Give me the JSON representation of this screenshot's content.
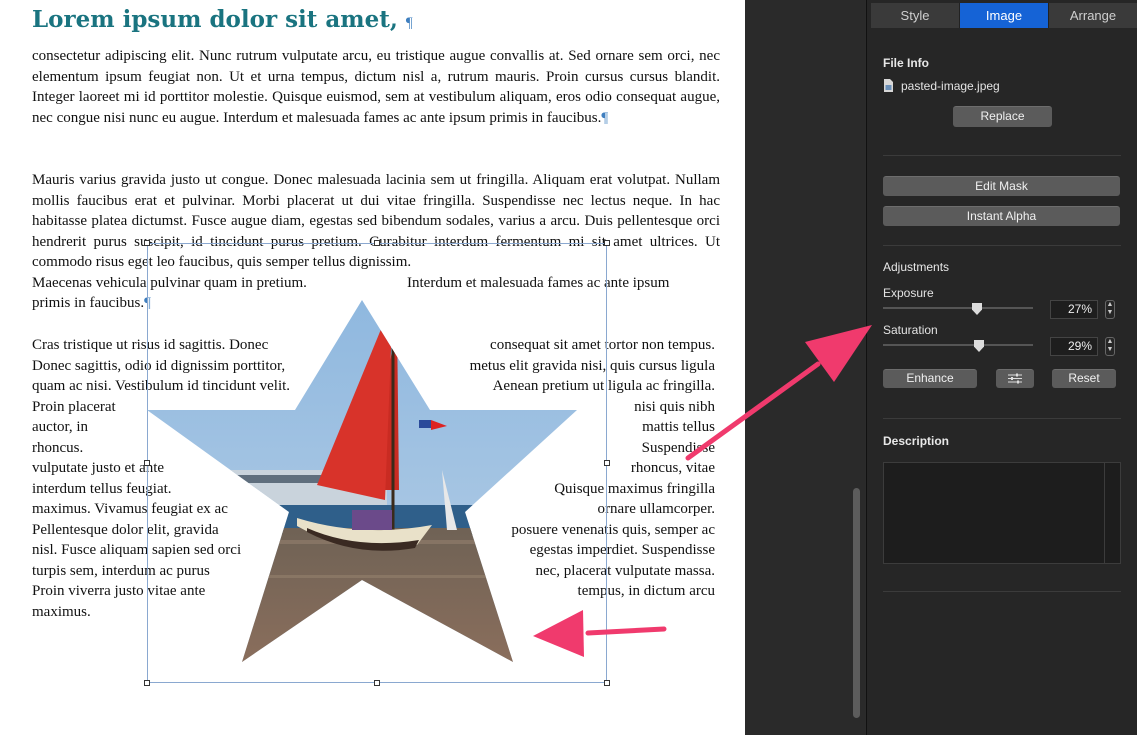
{
  "document": {
    "heading": "Lorem ipsum dolor sit amet,",
    "pilcrow": "¶",
    "para1": "consectetur adipiscing elit. Nunc rutrum vulputate arcu, eu tristique augue convallis at. Sed ornare sem orci, nec elementum ipsum feugiat non. Ut et urna tempus, dictum nisl a, rutrum mauris. Proin cursus cursus blandit. Integer laoreet mi id porttitor molestie. Quisque euismod, sem at vestibulum aliquam, eros odio consequat augue, nec congue nisi nunc eu augue. Interdum et malesuada fames ac ante ipsum primis in faucibus.",
    "para2": "Mauris varius gravida justo ut congue. Donec malesuada lacinia sem ut fringilla. Aliquam erat volutpat. Nullam mollis faucibus erat et pulvinar. Morbi placerat ut dui vitae fringilla. Suspendisse nec lectus neque. In hac habitasse platea dictumst. Fusce augue diam, egestas sed bibendum sodales, varius a arcu. Duis pellentesque orci hendrerit purus suscipit, id tincidunt purus pretium. Curabitur interdum fermentum mi sit amet ultrices. Ut commodo risus eget leo faucibus, quis semper tellus dignissim.",
    "para2_last_left": "Maecenas vehicula pulvinar quam in pretium.",
    "para2_last_right": "Interdum et malesuada fames ac ante ipsum",
    "para2_final": "primis in faucibus.",
    "para3_left": "Cras tristique ut risus id sagittis. Donec\nDonec sagittis, odio id dignissim porttitor,\nquam ac nisi. Vestibulum id tincidunt velit.\nProin placerat\nauctor, in\nrhoncus.\nvulputate justo et ante\ninterdum tellus feugiat.\nmaximus. Vivamus feugiat ex ac\nPellentesque dolor elit, gravida\nnisl. Fusce aliquam sapien sed orci\nturpis sem, interdum ac purus\nProin viverra justo vitae ante\nmaximus.",
    "para3_right": "consequat sit amet tortor non tempus.\nmetus elit gravida nisi, quis cursus ligula\nAenean pretium ut ligula ac fringilla.\nnisi quis nibh\nmattis tellus\nSuspendisse\nrhoncus, vitae\nQuisque maximus fringilla\nornare ullamcorper.\nposuere venenatis quis, semper ac\negestas imperdiet. Suspendisse\nnec, placerat vulputate massa.\ntempus, in dictum arcu"
  },
  "inspector": {
    "tabs": [
      "Style",
      "Image",
      "Arrange"
    ],
    "active_tab": "Image",
    "file_info_heading": "File Info",
    "file_name": "pasted-image.jpeg",
    "replace_label": "Replace",
    "edit_mask_label": "Edit Mask",
    "instant_alpha_label": "Instant Alpha",
    "adjustments_heading": "Adjustments",
    "exposure_label": "Exposure",
    "exposure_value": "27%",
    "exposure_level": 0.27,
    "saturation_label": "Saturation",
    "saturation_value": "29%",
    "saturation_level": 0.29,
    "enhance_label": "Enhance",
    "reset_label": "Reset",
    "description_heading": "Description",
    "description_value": ""
  },
  "colors": {
    "heading": "#1a7480",
    "active_tab": "#1563d6",
    "arrow": "#f03a6d",
    "panel_bg": "#262626"
  }
}
